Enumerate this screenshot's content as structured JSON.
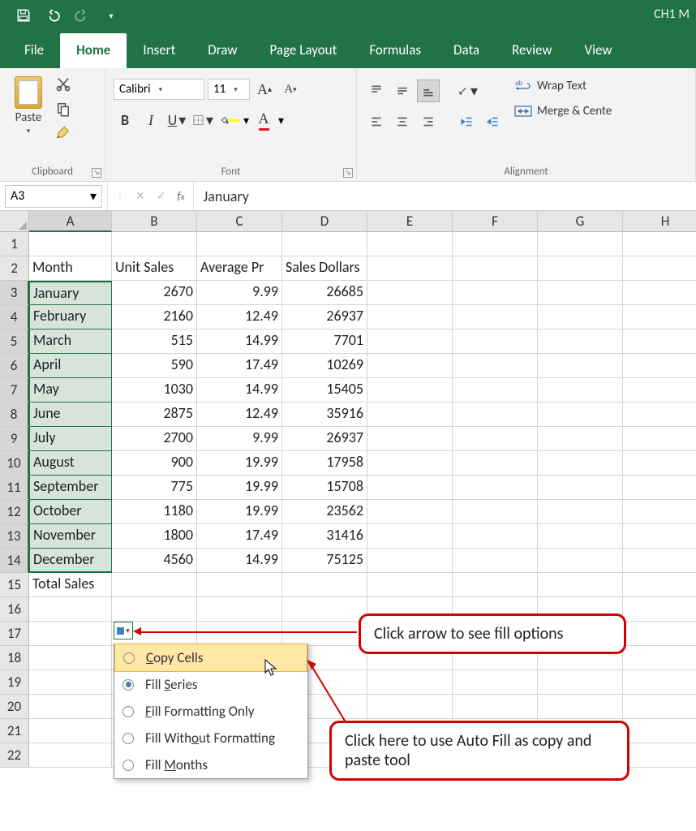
{
  "title": "CH1 M",
  "qat": {
    "save": "save-icon",
    "undo": "undo-icon",
    "redo": "redo-icon",
    "more": "more-icon"
  },
  "tabs": [
    "File",
    "Home",
    "Insert",
    "Draw",
    "Page Layout",
    "Formulas",
    "Data",
    "Review",
    "View"
  ],
  "active_tab": "Home",
  "ribbon": {
    "clipboard": {
      "label": "Clipboard",
      "paste": "Paste"
    },
    "font": {
      "label": "Font",
      "name": "Calibri",
      "size": "11",
      "bold": "B",
      "italic": "I",
      "underline": "U"
    },
    "alignment": {
      "label": "Alignment",
      "wrap": "Wrap Text",
      "merge": "Merge & Cente"
    }
  },
  "namebox": "A3",
  "formula_value": "January",
  "columns": [
    "A",
    "B",
    "C",
    "D",
    "E",
    "F",
    "G",
    "H"
  ],
  "rows": [
    "1",
    "2",
    "3",
    "4",
    "5",
    "6",
    "7",
    "8",
    "9",
    "10",
    "11",
    "12",
    "13",
    "14",
    "15",
    "16",
    "17",
    "18",
    "19",
    "20",
    "21",
    "22"
  ],
  "selected_column_index": 0,
  "headers": {
    "A": "Month",
    "B": "Unit Sales",
    "C": "Average Pr",
    "D": "Sales Dollars"
  },
  "data_rows": [
    {
      "A": "January",
      "B": "2670",
      "C": "9.99",
      "D": "26685"
    },
    {
      "A": "February",
      "B": "2160",
      "C": "12.49",
      "D": "26937"
    },
    {
      "A": "March",
      "B": "515",
      "C": "14.99",
      "D": "7701"
    },
    {
      "A": "April",
      "B": "590",
      "C": "17.49",
      "D": "10269"
    },
    {
      "A": "May",
      "B": "1030",
      "C": "14.99",
      "D": "15405"
    },
    {
      "A": "June",
      "B": "2875",
      "C": "12.49",
      "D": "35916"
    },
    {
      "A": "July",
      "B": "2700",
      "C": "9.99",
      "D": "26937"
    },
    {
      "A": "August",
      "B": "900",
      "C": "19.99",
      "D": "17958"
    },
    {
      "A": "September",
      "B": "775",
      "C": "19.99",
      "D": "15708"
    },
    {
      "A": "October",
      "B": "1180",
      "C": "19.99",
      "D": "23562"
    },
    {
      "A": "November",
      "B": "1800",
      "C": "17.49",
      "D": "31416"
    },
    {
      "A": "December",
      "B": "4560",
      "C": "14.99",
      "D": "75125"
    }
  ],
  "total_label": "Total Sales",
  "fill_menu": {
    "items": [
      {
        "label": "Copy Cells",
        "access": "C"
      },
      {
        "label": "Fill Series",
        "access": "S",
        "checked": true
      },
      {
        "label": "Fill Formatting Only",
        "access": "F"
      },
      {
        "label": "Fill Without Formatting",
        "access": "o"
      },
      {
        "label": "Fill Months",
        "access": "M"
      }
    ],
    "hover_index": 0
  },
  "callouts": {
    "c1": "Click arrow to see fill options",
    "c2": "Click here to use Auto Fill as copy and paste tool"
  },
  "chart_data": {
    "type": "table",
    "title": "",
    "columns": [
      "Month",
      "Unit Sales",
      "Average Pr",
      "Sales Dollars"
    ],
    "rows": [
      [
        "January",
        2670,
        9.99,
        26685
      ],
      [
        "February",
        2160,
        12.49,
        26937
      ],
      [
        "March",
        515,
        14.99,
        7701
      ],
      [
        "April",
        590,
        17.49,
        10269
      ],
      [
        "May",
        1030,
        14.99,
        15405
      ],
      [
        "June",
        2875,
        12.49,
        35916
      ],
      [
        "July",
        2700,
        9.99,
        26937
      ],
      [
        "August",
        900,
        19.99,
        17958
      ],
      [
        "September",
        775,
        19.99,
        15708
      ],
      [
        "October",
        1180,
        19.99,
        23562
      ],
      [
        "November",
        1800,
        17.49,
        31416
      ],
      [
        "December",
        4560,
        14.99,
        75125
      ]
    ]
  }
}
